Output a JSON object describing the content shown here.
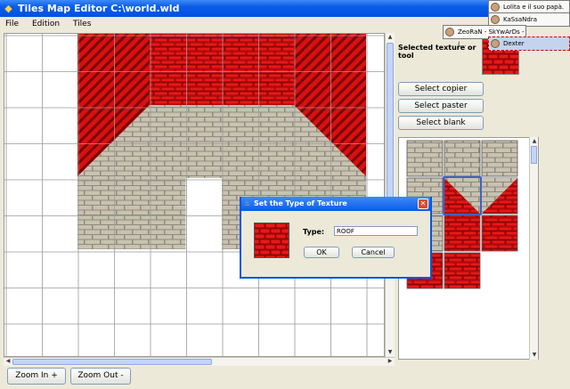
{
  "window": {
    "title": "Tiles Map Editor C:\\world.wld"
  },
  "menu": [
    {
      "label": "File"
    },
    {
      "label": "Edition"
    },
    {
      "label": "Tiles"
    }
  ],
  "side_panel": {
    "selected_label": "Selected texture or tool",
    "buttons": {
      "copier": "Select copier",
      "paster": "Select paster",
      "blank": "Select blank"
    }
  },
  "bottom": {
    "zoom_in": "Zoom In +",
    "zoom_out": "Zoom Out -"
  },
  "dialog": {
    "title": "Set the Type of Texture",
    "type_label": "Type:",
    "type_value": "ROOF",
    "ok": "OK",
    "cancel": "Cancel"
  },
  "notifications": [
    {
      "name": "Lolita e il suo papà."
    },
    {
      "name": "KaSsaNdra"
    },
    {
      "name": "ZeoRaN - SkYwArDs -(..."
    },
    {
      "name": "Dexter"
    }
  ],
  "icons": {
    "app": "app-icon",
    "close": "close-icon",
    "dialog": "java-icon",
    "avatar": "avatar-icon"
  },
  "colors": {
    "title_blue": "#0a5ce8",
    "roof_red": "#d81010",
    "wall_gray": "#c9c2b0"
  }
}
